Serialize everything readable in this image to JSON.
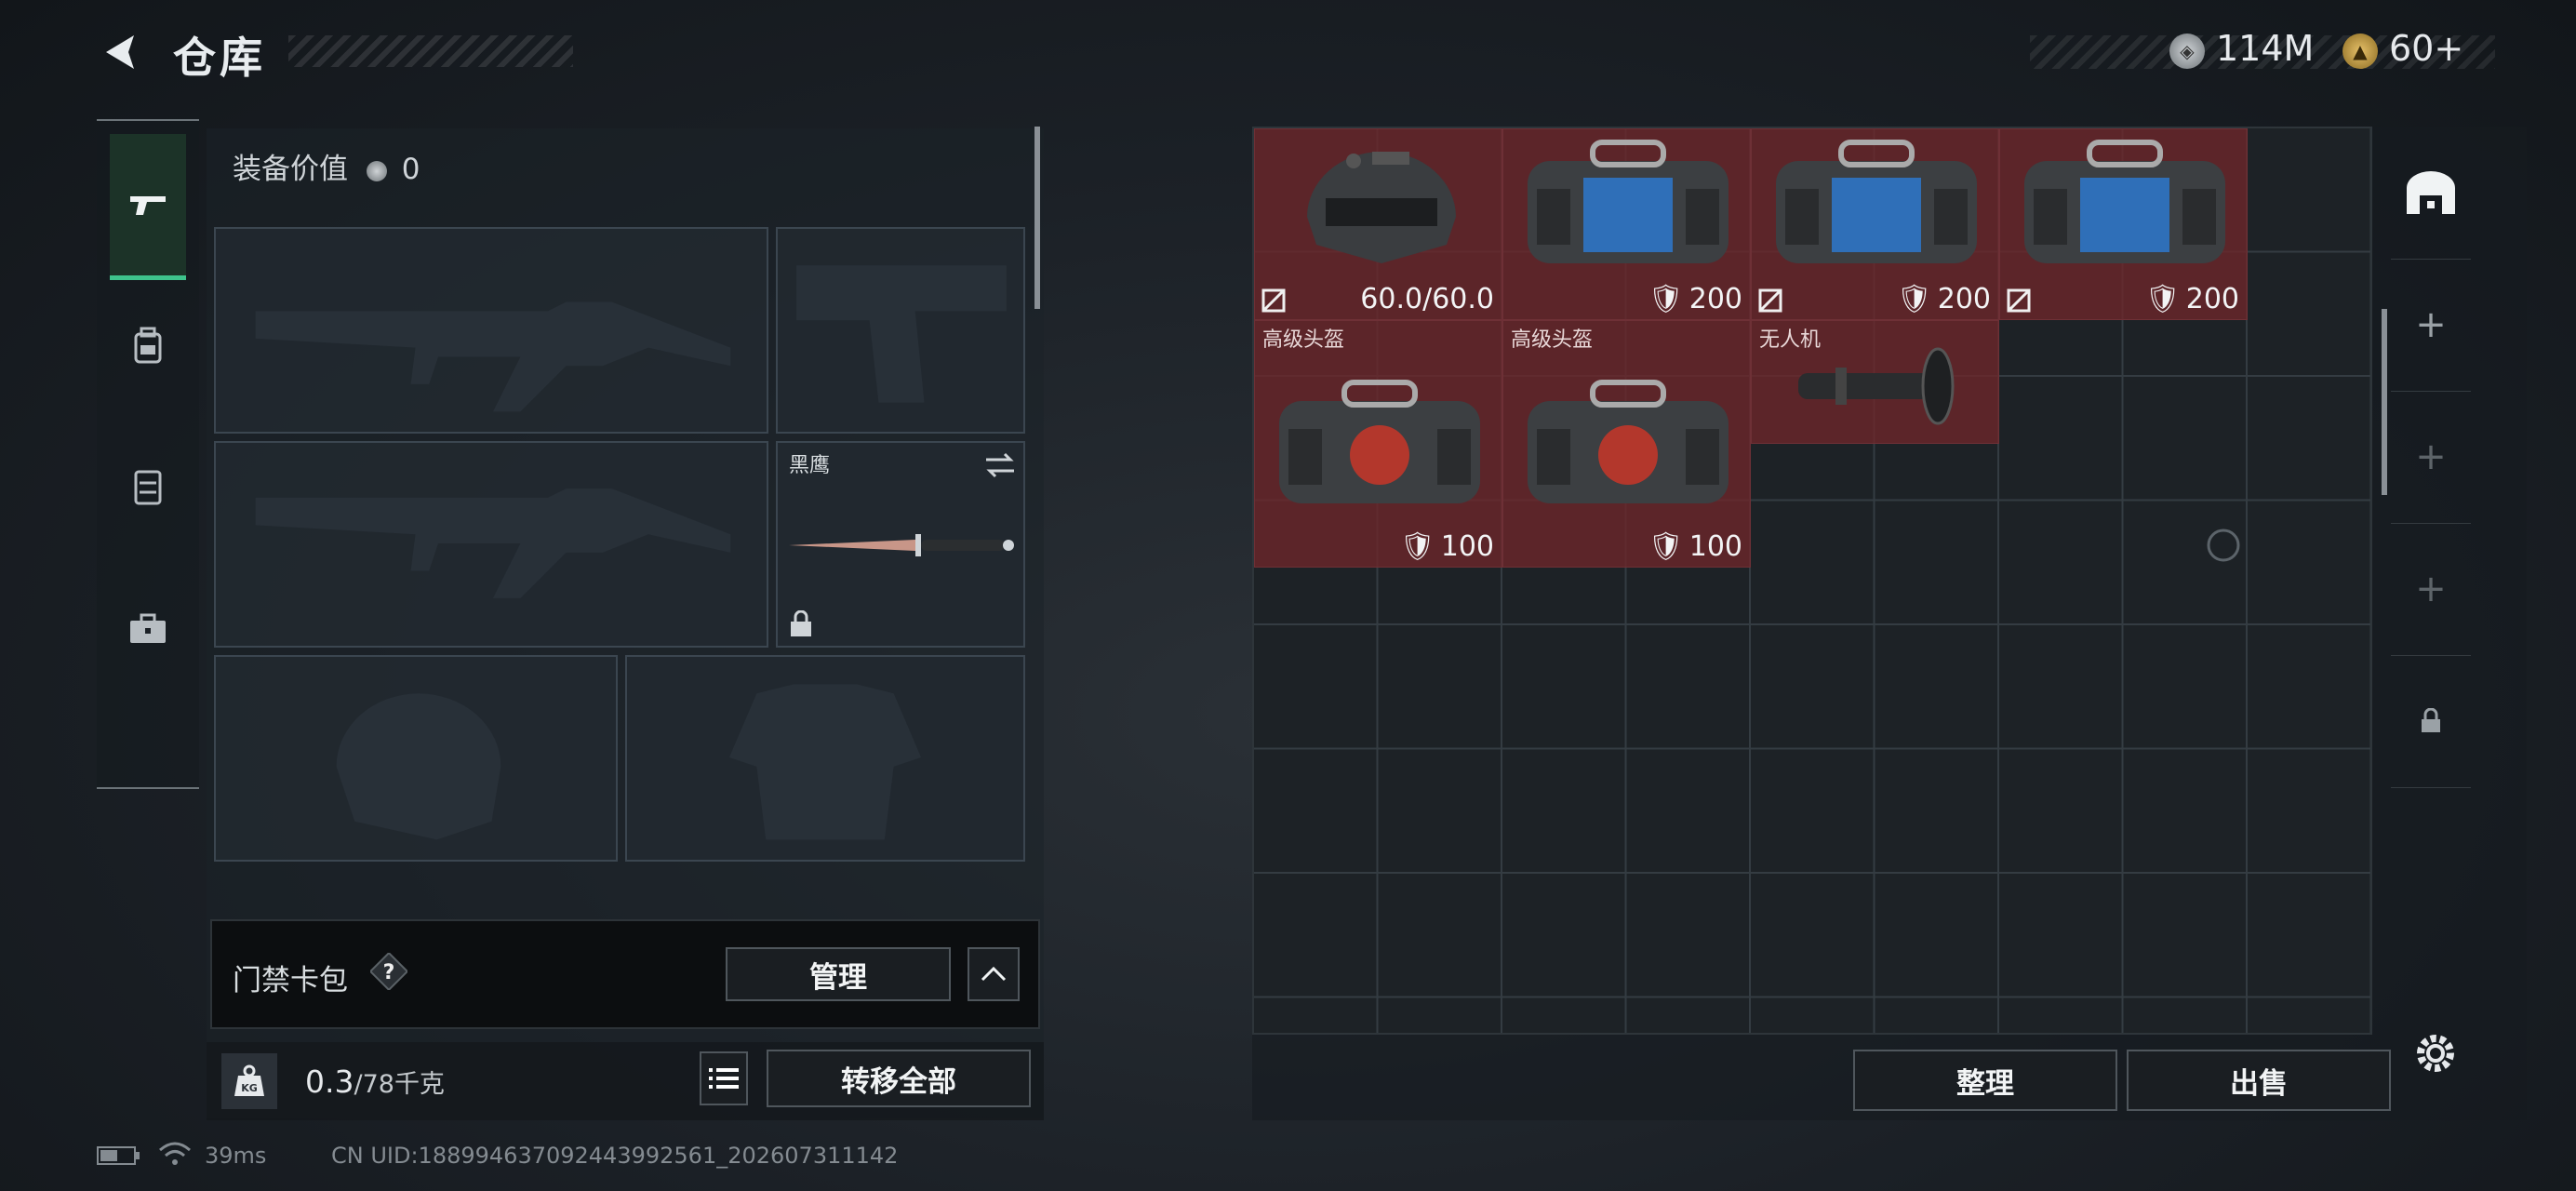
{
  "header": {
    "title": "仓库"
  },
  "currency": [
    {
      "icon": "silver-coin-icon",
      "value": "114M"
    },
    {
      "icon": "gold-coin-icon",
      "value": "60+"
    }
  ],
  "equipment": {
    "value_label": "装备价值",
    "value": "0",
    "knife_name": "黑鹰"
  },
  "side_tabs": [
    "gun-icon",
    "backpack-icon",
    "vest-icon",
    "toolbox-icon"
  ],
  "card_pack": {
    "label": "门禁卡包",
    "help": "?",
    "manage": "管理"
  },
  "weight": {
    "current": "0.3",
    "max": "/78千克",
    "kg": "KG"
  },
  "transfer_all": "转移全部",
  "status": {
    "ping": "39ms",
    "uid": "CN UID:188994637092443992561_202607311142"
  },
  "storage_items": [
    {
      "name": "",
      "value": "60.0/60.0",
      "type": "durability"
    },
    {
      "name": "",
      "value": "200",
      "type": "armor"
    },
    {
      "name": "",
      "value": "200",
      "type": "armor"
    },
    {
      "name": "",
      "value": "200",
      "type": "armor"
    },
    {
      "name": "高级头盔",
      "value": "100",
      "type": "armor"
    },
    {
      "name": "高级头盔",
      "value": "100",
      "type": "armor"
    },
    {
      "name": "无人机",
      "value": "",
      "type": "part"
    }
  ],
  "actions": {
    "sort": "整理",
    "sell": "出售"
  },
  "colors": {
    "item_bg": "#6e262a",
    "accent": "#3ec38c"
  }
}
